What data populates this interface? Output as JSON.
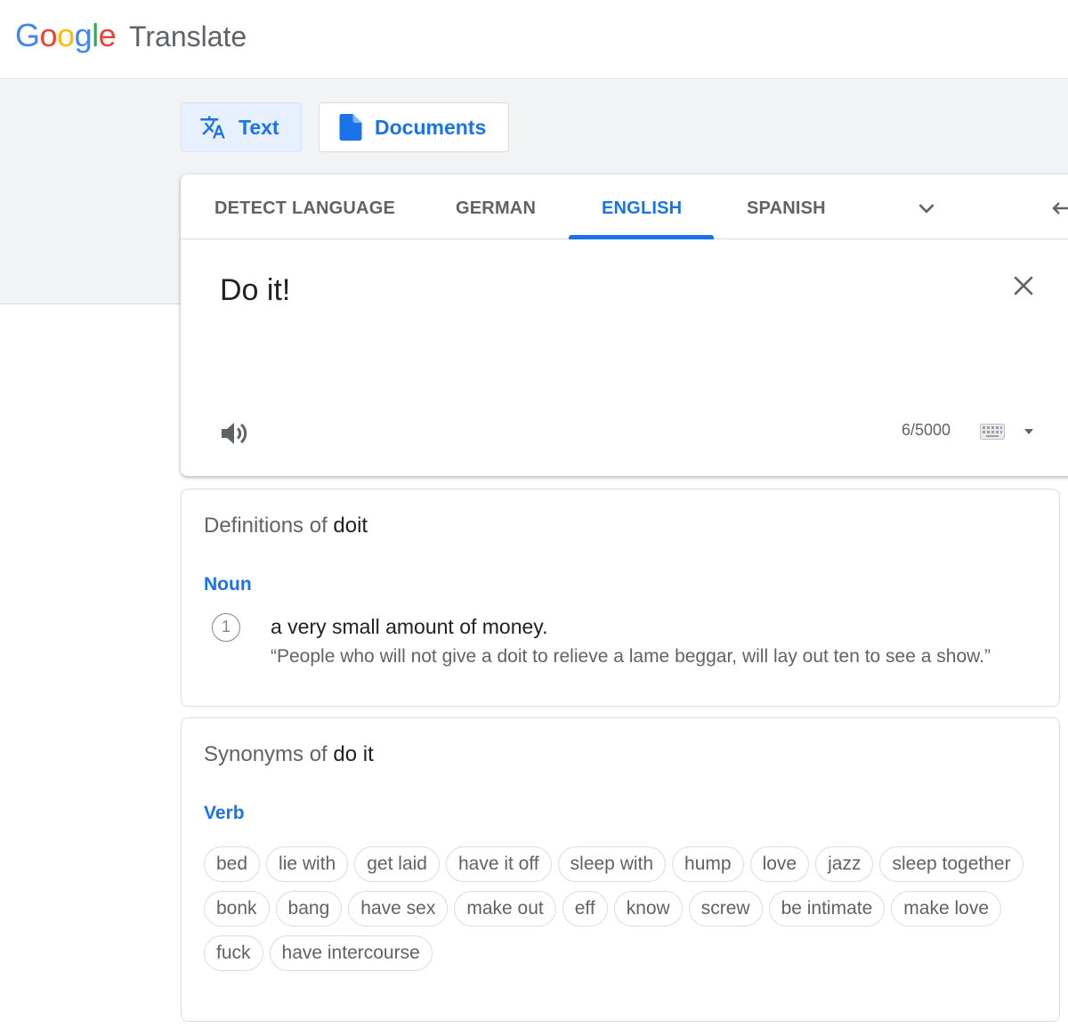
{
  "header": {
    "logo_letters": [
      {
        "ch": "G",
        "color": "#4285F4"
      },
      {
        "ch": "o",
        "color": "#EA4335"
      },
      {
        "ch": "o",
        "color": "#FBBC05"
      },
      {
        "ch": "g",
        "color": "#4285F4"
      },
      {
        "ch": "l",
        "color": "#34A853"
      },
      {
        "ch": "e",
        "color": "#EA4335"
      }
    ],
    "product_name": "Translate"
  },
  "modes": {
    "text_label": "Text",
    "documents_label": "Documents"
  },
  "languages": {
    "tabs": [
      "DETECT LANGUAGE",
      "GERMAN",
      "ENGLISH",
      "SPANISH"
    ],
    "active": "ENGLISH"
  },
  "source": {
    "text": "Do it!",
    "char_count": "6/5000"
  },
  "definitions": {
    "title_prefix": "Definitions of ",
    "term": "doit",
    "part_of_speech": "Noun",
    "entries": [
      {
        "number": "1",
        "text": "a very small amount of money.",
        "example": "“People who will not give a doit to relieve a lame beggar, will lay out ten to see a show.”"
      }
    ]
  },
  "synonyms": {
    "title_prefix": "Synonyms of ",
    "term": "do it",
    "part_of_speech": "Verb",
    "rows": [
      [
        "bed",
        "lie with",
        "get laid",
        "have it off",
        "sleep with",
        "hump",
        "love",
        "jazz",
        "sleep together"
      ],
      [
        "bonk",
        "bang",
        "have sex",
        "make out",
        "eff",
        "know",
        "screw",
        "be intimate",
        "make love"
      ],
      [
        "fuck",
        "have intercourse"
      ]
    ]
  },
  "colors": {
    "accent": "#1a73e8",
    "text_secondary": "#5f6368",
    "band": "#f1f3f4"
  }
}
